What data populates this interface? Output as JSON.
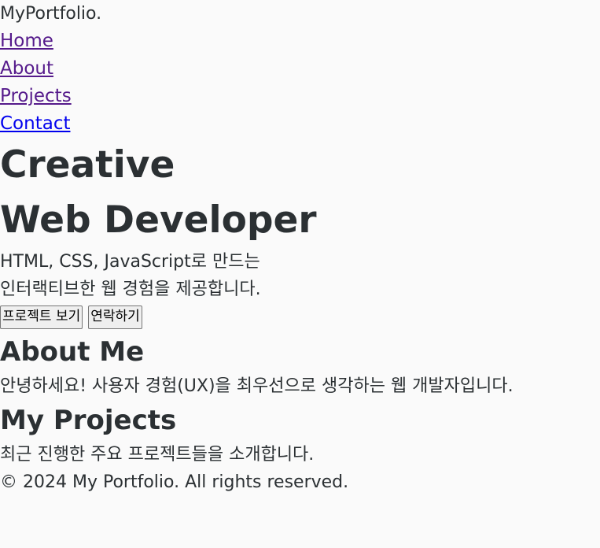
{
  "header": {
    "logo": "MyPortfolio.",
    "nav": [
      {
        "label": "Home"
      },
      {
        "label": "About"
      },
      {
        "label": "Projects"
      },
      {
        "label": "Contact"
      }
    ]
  },
  "hero": {
    "title_line1": "Creative",
    "title_line2": "Web Developer",
    "subtitle_line1": "HTML, CSS, JavaScript로 만드는",
    "subtitle_line2": "인터랙티브한 웹 경험을 제공합니다.",
    "primary_button": "프로젝트 보기",
    "secondary_button": "연락하기"
  },
  "about": {
    "heading": "About Me",
    "text": "안녕하세요! 사용자 경험(UX)을 최우선으로 생각하는 웹 개발자입니다."
  },
  "projects": {
    "heading": "My Projects",
    "text": "최근 진행한 주요 프로젝트들을 소개합니다."
  },
  "footer": {
    "copyright": "© 2024 My Portfolio. All rights reserved."
  },
  "colors": {
    "background": "#fafafa",
    "text": "#2b3033",
    "link_visited": "#551a8b",
    "link_unvisited": "#0000ee"
  }
}
